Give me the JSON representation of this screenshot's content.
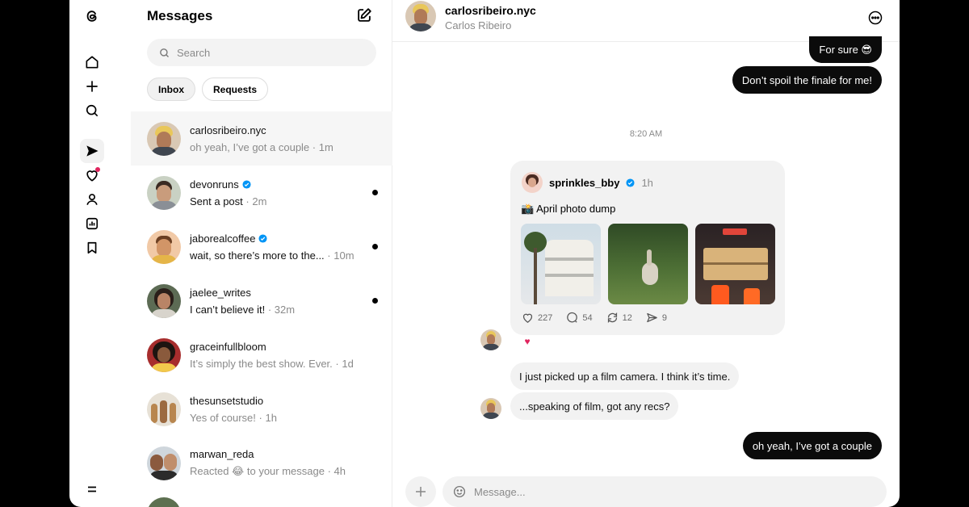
{
  "rail": {
    "icons": [
      "threads-logo-icon",
      "home-icon",
      "plus-icon",
      "search-icon",
      "send-icon",
      "heart-icon",
      "profile-icon",
      "insights-icon",
      "bookmark-icon",
      "menu-icon"
    ]
  },
  "list": {
    "title": "Messages",
    "search_placeholder": "Search",
    "tabs": [
      {
        "label": "Inbox"
      },
      {
        "label": "Requests"
      }
    ],
    "conversations": [
      {
        "name": "carlosribeiro.nyc",
        "preview": "oh yeah, I’ve got a couple",
        "time": "· 1m",
        "verified": false,
        "unread": false
      },
      {
        "name": "devonruns",
        "preview": "Sent a post",
        "time": "· 2m",
        "verified": true,
        "unread": true
      },
      {
        "name": "jaborealcoffee",
        "preview": "wait, so there’s more to the...",
        "time": "· 10m",
        "verified": true,
        "unread": true
      },
      {
        "name": "jaelee_writes",
        "preview": "I can’t believe it!",
        "time": "· 32m",
        "verified": false,
        "unread": true
      },
      {
        "name": "graceinfullbloom",
        "preview": "It’s simply the best show. Ever.",
        "time": "· 1d",
        "verified": false,
        "unread": false
      },
      {
        "name": "thesunsetstudio",
        "preview": "Yes of course!",
        "time": "· 1h",
        "verified": false,
        "unread": false
      },
      {
        "name": "marwan_reda",
        "preview_prefix": "Reacted",
        "preview_emoji": "😂",
        "preview": "to your message",
        "time": "· 4h",
        "verified": false,
        "unread": false
      }
    ]
  },
  "chat": {
    "username": "carlosribeiro.nyc",
    "real_name": "Carlos Ribeiro",
    "messages": {
      "m1": "For sure 😎",
      "m2": "Don’t spoil the finale for me!",
      "m2_reaction": "♥",
      "timestamp": "8:20 AM",
      "post": {
        "user": "sprinkles_bby",
        "time": "1h",
        "caption": "📸 April photo dump",
        "likes": "227",
        "comments": "54",
        "reposts": "12",
        "shares": "9"
      },
      "post_reaction": "♥",
      "m3": "I just picked up a film camera. I think it’s time.",
      "m4": "...speaking of film, got any recs?",
      "m5": "oh yeah, I’ve got a couple"
    },
    "composer_placeholder": "Message..."
  },
  "colors": {
    "accent_verified": "#0095f6",
    "bubble_out": "#0b0b0b",
    "bubble_in": "#f2f2f2",
    "heart": "#e0245e"
  }
}
